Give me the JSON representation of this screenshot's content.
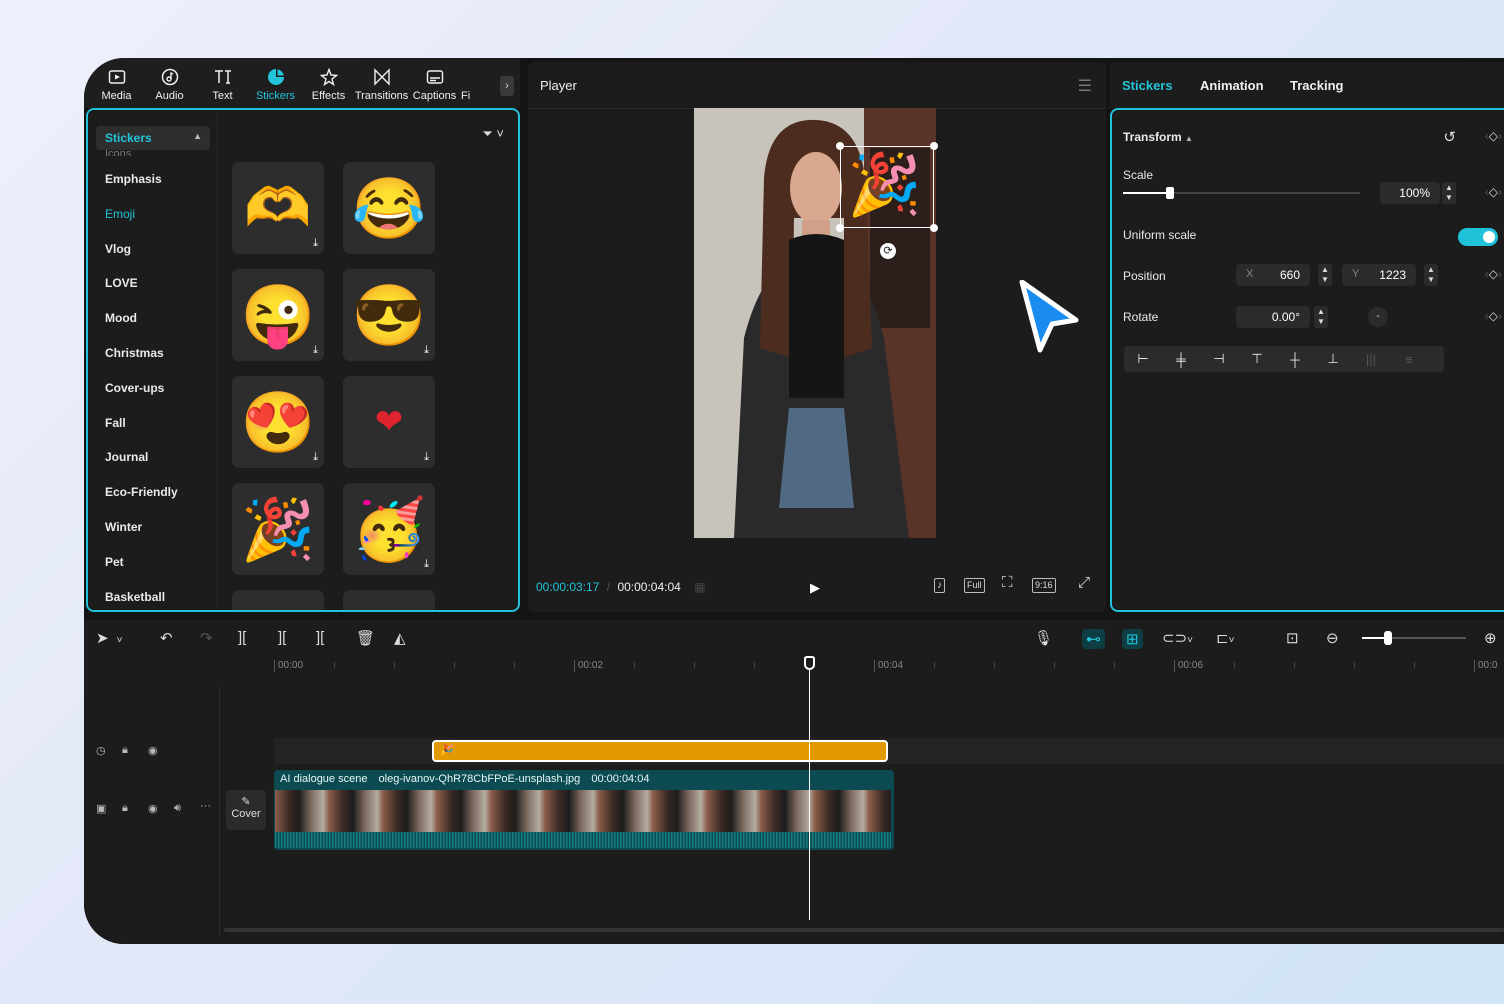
{
  "toolbar": {
    "tools": [
      {
        "label": "Media",
        "icon": "media-icon"
      },
      {
        "label": "Audio",
        "icon": "audio-icon"
      },
      {
        "label": "Text",
        "icon": "text-icon"
      },
      {
        "label": "Stickers",
        "icon": "stickers-icon",
        "active": true
      },
      {
        "label": "Effects",
        "icon": "effects-icon"
      },
      {
        "label": "Transitions",
        "icon": "transitions-icon"
      },
      {
        "label": "Captions",
        "icon": "captions-icon"
      },
      {
        "label": "Fi",
        "icon": "filters-icon"
      }
    ]
  },
  "sticker_panel": {
    "dropdown_label": "Stickers",
    "ghost_label": "Icons",
    "categories": [
      "Emphasis",
      "Emoji",
      "Vlog",
      "LOVE",
      "Mood",
      "Christmas",
      "Cover-ups",
      "Fall",
      "Journal",
      "Eco-Friendly",
      "Winter",
      "Pet",
      "Basketball"
    ],
    "active_category": "Emoji",
    "stickers": [
      "🫶",
      "😂",
      "😜",
      "😎",
      "😍",
      "❤",
      "🎉",
      "🥳",
      "☁",
      "⭐"
    ]
  },
  "player": {
    "title": "Player",
    "current_time": "00:00:03:17",
    "total_time": "00:00:04:04",
    "ratio_label": "9:16",
    "full_label": "Full"
  },
  "properties": {
    "tabs": [
      "Stickers",
      "Animation",
      "Tracking"
    ],
    "active_tab": "Stickers",
    "section": "Transform",
    "scale_label": "Scale",
    "scale_value": "100%",
    "scale_fraction": 0.2,
    "uniform_scale_label": "Uniform scale",
    "uniform_scale_on": true,
    "position_label": "Position",
    "x_axis": "X",
    "x_value": "660",
    "y_axis": "Y",
    "y_value": "1223",
    "rotate_label": "Rotate",
    "rotate_value": "0.00°"
  },
  "timeline": {
    "ruler_labels": [
      "00:00",
      "00:02",
      "00:04",
      "00:06",
      "00:0"
    ],
    "sticker_clip_icon": "🎉",
    "video_clip": {
      "name": "AI dialogue scene",
      "file": "oleg-ivanov-QhR78CbFPoE-unsplash.jpg",
      "duration": "00:00:04:04"
    },
    "cover_label": "Cover"
  },
  "colors": {
    "accent": "#1fc2d8",
    "sticker_clip": "#e39a00",
    "video_clip": "#0b4b51"
  }
}
